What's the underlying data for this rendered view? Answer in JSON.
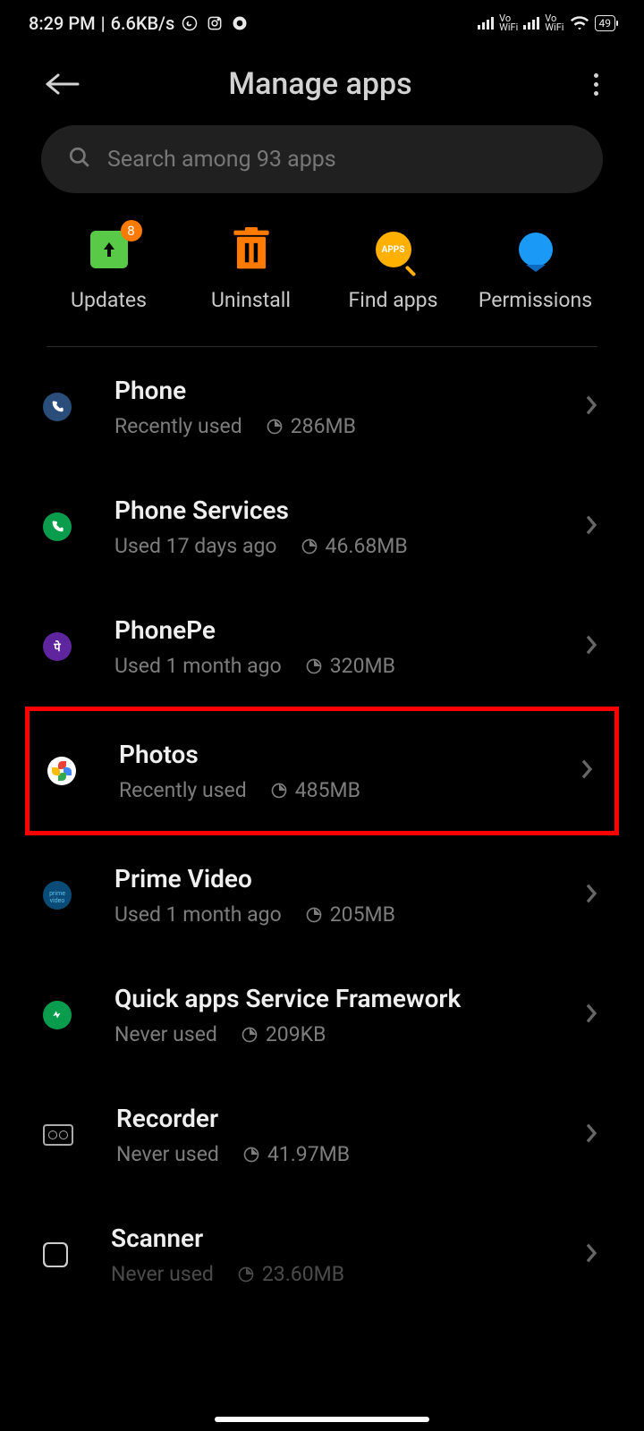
{
  "status": {
    "time": "8:29 PM",
    "separator": "|",
    "speed": "6.6KB/s",
    "battery": "49"
  },
  "header": {
    "title": "Manage apps"
  },
  "search": {
    "placeholder": "Search among 93 apps"
  },
  "actions": {
    "updates": {
      "label": "Updates",
      "badge": "8"
    },
    "uninstall": {
      "label": "Uninstall"
    },
    "find_apps": {
      "label": "Find apps",
      "icon_text": "APPS"
    },
    "permissions": {
      "label": "Permissions"
    }
  },
  "apps": [
    {
      "name": "Phone",
      "usage": "Recently used",
      "size": "286MB"
    },
    {
      "name": "Phone Services",
      "usage": "Used 17 days ago",
      "size": "46.68MB"
    },
    {
      "name": "PhonePe",
      "usage": "Used 1 month ago",
      "size": "320MB"
    },
    {
      "name": "Photos",
      "usage": "Recently used",
      "size": "485MB"
    },
    {
      "name": "Prime Video",
      "usage": "Used 1 month ago",
      "size": "205MB"
    },
    {
      "name": "Quick apps Service Framework",
      "usage": "Never used",
      "size": "209KB"
    },
    {
      "name": "Recorder",
      "usage": "Never used",
      "size": "41.97MB"
    },
    {
      "name": "Scanner",
      "usage": "Never used",
      "size": "23.60MB"
    }
  ]
}
